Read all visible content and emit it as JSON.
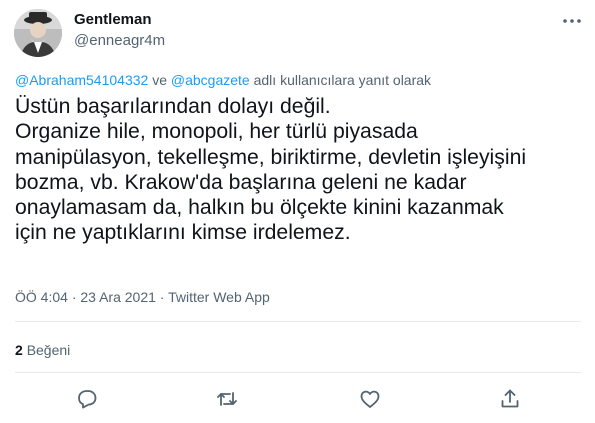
{
  "author": {
    "name": "Gentleman",
    "handle": "@enneagr4m"
  },
  "reply_context": {
    "mention_1": "@Abraham54104332",
    "connector": "ve",
    "mention_2": "@abcgazete",
    "suffix": "adlı kullanıcılara yanıt olarak"
  },
  "tweet": {
    "lines": [
      "Üstün başarılarından dolayı değil.",
      "Organize hile, monopoli, her türlü piyasada",
      "manipülasyon, tekelleşme, biriktirme, devletin işleyişini",
      "bozma, vb. Krakow'da başlarına geleni ne kadar",
      "onaylamasam da, halkın bu ölçekte kinini kazanmak",
      "için ne yaptıklarını kimse irdelemez."
    ]
  },
  "meta": {
    "time": "ÖÖ 4:04",
    "separator": "·",
    "date": "23 Ara 2021",
    "source": "Twitter Web App"
  },
  "stats": {
    "likes_count": "2",
    "likes_label": "Beğeni"
  },
  "icons": {
    "more": "more-horizontal-icon",
    "reply": "reply-icon",
    "retweet": "retweet-icon",
    "like": "heart-icon",
    "share": "share-icon"
  },
  "colors": {
    "link": "#1d9bf0",
    "secondary_text": "#536471",
    "primary_text": "#0f1419",
    "divider": "#e7e9ea"
  }
}
